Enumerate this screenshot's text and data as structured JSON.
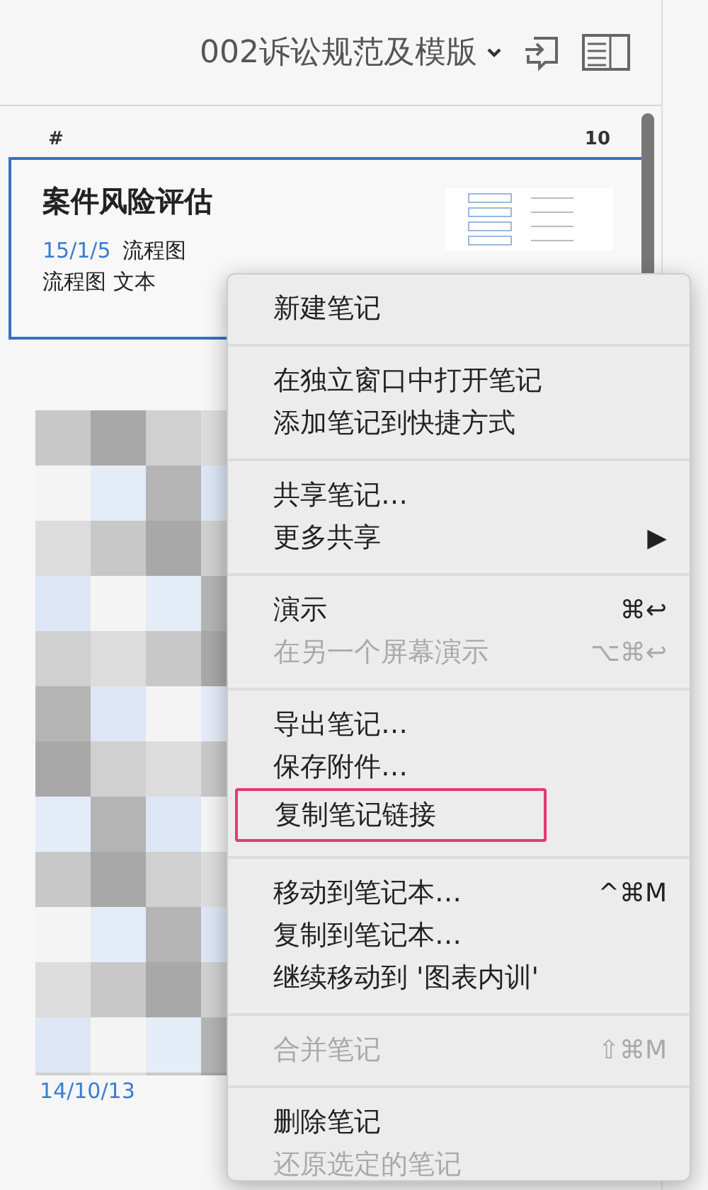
{
  "header": {
    "notebook_title": "002诉讼规范及模版"
  },
  "list_header": {
    "sort_label": "#",
    "count": "10"
  },
  "notes": [
    {
      "title": "案件风险评估",
      "date": "15/1/5",
      "snippet_line1": "流程图",
      "snippet_line2": "流程图 文本",
      "selected": true
    },
    {
      "kind": "picture",
      "date": "14/10/13"
    }
  ],
  "context_menu": {
    "sections": [
      [
        {
          "label": "新建笔记",
          "disabled": false,
          "marked": false
        }
      ],
      [
        {
          "label": "在独立窗口中打开笔记",
          "disabled": false,
          "marked": false
        },
        {
          "label": "添加笔记到快捷方式",
          "disabled": false,
          "marked": false
        }
      ],
      [
        {
          "label": "共享笔记…",
          "disabled": false,
          "marked": false
        },
        {
          "label": "更多共享",
          "arrow": "▶",
          "disabled": false,
          "marked": false
        }
      ],
      [
        {
          "label": "演示",
          "shortcut": "⌘↩",
          "disabled": false,
          "marked": false
        },
        {
          "label": "在另一个屏幕演示",
          "shortcut": "⌥⌘↩",
          "disabled": true,
          "marked": false
        }
      ],
      [
        {
          "label": "导出笔记…",
          "disabled": false,
          "marked": false
        },
        {
          "label": "保存附件…",
          "disabled": false,
          "marked": false
        },
        {
          "label": "复制笔记链接",
          "disabled": false,
          "marked": true
        }
      ],
      [
        {
          "label": "移动到笔记本…",
          "shortcut": "^⌘M",
          "disabled": false,
          "marked": false
        },
        {
          "label": "复制到笔记本…",
          "disabled": false,
          "marked": false
        },
        {
          "label": "继续移动到 '图表内训'",
          "disabled": false,
          "marked": false
        }
      ],
      [
        {
          "label": "合并笔记",
          "shortcut": "⇧⌘M",
          "disabled": true,
          "marked": false
        }
      ],
      [
        {
          "label": "删除笔记",
          "disabled": false,
          "marked": false
        },
        {
          "label": "还原选定的笔记",
          "disabled": true,
          "marked": false
        }
      ]
    ]
  }
}
